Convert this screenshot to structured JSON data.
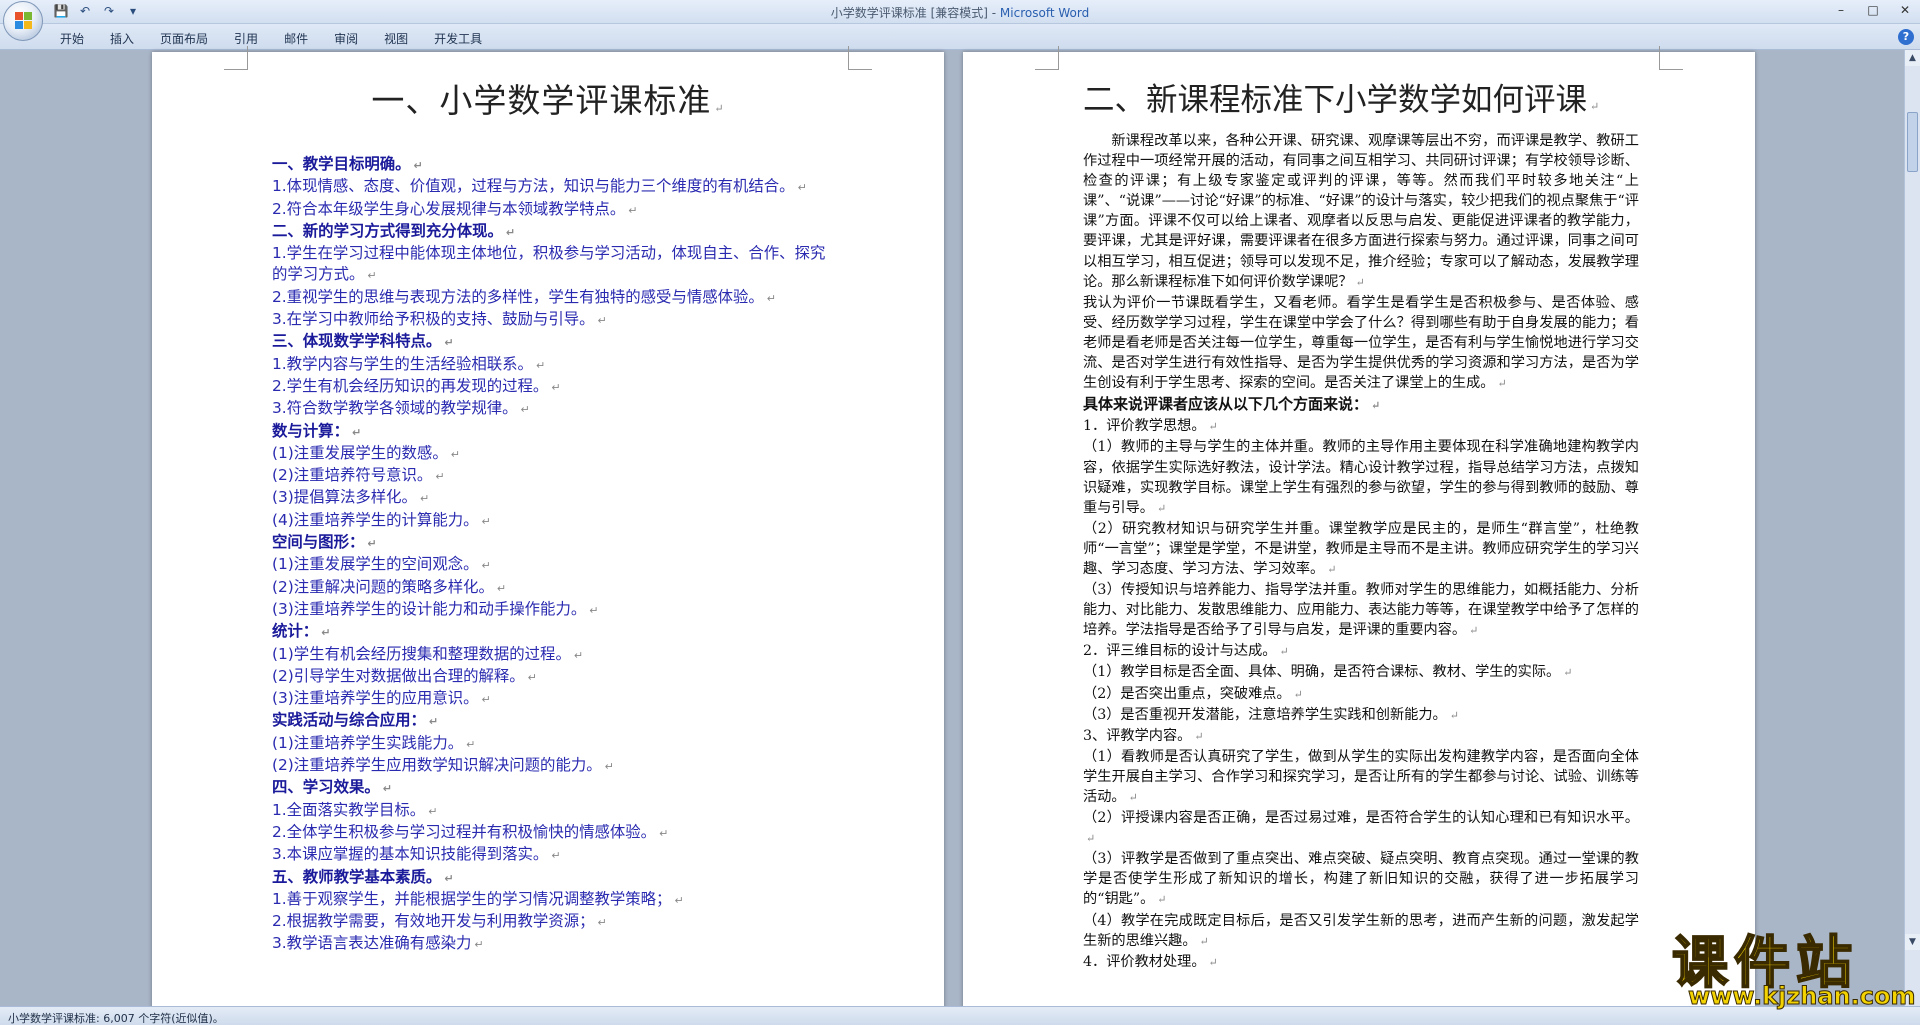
{
  "window": {
    "title": "小学数学评课标准 [兼容模式] - ",
    "app_name": "Microsoft Word",
    "controls": [
      "–",
      "□",
      "✕"
    ]
  },
  "ribbon": {
    "tabs": [
      "开始",
      "插入",
      "页面布局",
      "引用",
      "邮件",
      "审阅",
      "视图",
      "开发工具"
    ],
    "help": "?"
  },
  "page1": {
    "title": "一、小学数学评课标准",
    "lines": [
      {
        "text": "一、教学目标明确。",
        "head": true
      },
      {
        "text": "1.体现情感、态度、价值观，过程与方法，知识与能力三个维度的有机结合。",
        "head": false
      },
      {
        "text": "2.符合本年级学生身心发展规律与本领域教学特点。",
        "head": false
      },
      {
        "text": "二、新的学习方式得到充分体现。",
        "head": true
      },
      {
        "text": "1.学生在学习过程中能体现主体地位，积极参与学习活动，体现自主、合作、探究的学习方式。",
        "head": false
      },
      {
        "text": "2.重视学生的思维与表现方法的多样性，学生有独特的感受与情感体验。",
        "head": false
      },
      {
        "text": "3.在学习中教师给予积极的支持、鼓励与引导。",
        "head": false
      },
      {
        "text": "三、体现数学学科特点。",
        "head": true
      },
      {
        "text": "1.教学内容与学生的生活经验相联系。",
        "head": false
      },
      {
        "text": "2.学生有机会经历知识的再发现的过程。",
        "head": false
      },
      {
        "text": "3.符合数学教学各领域的教学规律。",
        "head": false
      },
      {
        "text": "数与计算：",
        "head": true
      },
      {
        "text": "(1)注重发展学生的数感。",
        "head": false
      },
      {
        "text": "(2)注重培养符号意识。",
        "head": false
      },
      {
        "text": "(3)提倡算法多样化。",
        "head": false
      },
      {
        "text": "(4)注重培养学生的计算能力。",
        "head": false
      },
      {
        "text": "空间与图形：",
        "head": true
      },
      {
        "text": "(1)注重发展学生的空间观念。",
        "head": false
      },
      {
        "text": "(2)注重解决问题的策略多样化。",
        "head": false
      },
      {
        "text": "(3)注重培养学生的设计能力和动手操作能力。",
        "head": false
      },
      {
        "text": "统计：",
        "head": true
      },
      {
        "text": "(1)学生有机会经历搜集和整理数据的过程。",
        "head": false
      },
      {
        "text": "(2)引导学生对数据做出合理的解释。",
        "head": false
      },
      {
        "text": "(3)注重培养学生的应用意识。",
        "head": false
      },
      {
        "text": "实践活动与综合应用：",
        "head": true
      },
      {
        "text": "(1)注重培养学生实践能力。",
        "head": false
      },
      {
        "text": "(2)注重培养学生应用数学知识解决问题的能力。",
        "head": false
      },
      {
        "text": "四、学习效果。",
        "head": true
      },
      {
        "text": "1.全面落实教学目标。",
        "head": false
      },
      {
        "text": "2.全体学生积极参与学习过程并有积极愉快的情感体验。",
        "head": false
      },
      {
        "text": "3.本课应掌握的基本知识技能得到落实。",
        "head": false
      },
      {
        "text": "五、教师教学基本素质。",
        "head": true
      },
      {
        "text": "1.善于观察学生，并能根据学生的学习情况调整教学策略；",
        "head": false
      },
      {
        "text": "2.根据教学需要，有效地开发与利用教学资源；",
        "head": false
      },
      {
        "text": "3.教学语言表达准确有感染力",
        "head": false
      }
    ]
  },
  "page2": {
    "title": "二、新课程标准下小学数学如何评课",
    "paragraphs": [
      {
        "text": "新课程改革以来，各种公开课、研究课、观摩课等层出不穷，而评课是教学、教研工作过程中一项经常开展的活动，有同事之间互相学习、共同研讨评课；有学校领导诊断、检查的评课；有上级专家鉴定或评判的评课，等等。然而我们平时较多地关注“上课”、“说课”——讨论“好课”的标准、“好课”的设计与落实，较少把我们的视点聚焦于“评课”方面。评课不仅可以给上课者、观摩者以反思与启发、更能促进评课者的教学能力，要评课，尤其是评好课，需要评课者在很多方面进行探索与努力。通过评课，同事之间可以相互学习，相互促进；领导可以发现不足，推介经验；专家可以了解动态，发展教学理论。那么新课程标准下如何评价数学课呢？",
        "style": "indent"
      },
      {
        "text": "我认为评价一节课既看学生，又看老师。看学生是看学生是否积极参与、是否体验、感受、经历数学学习过程，学生在课堂中学会了什么？得到哪些有助于自身发展的能力；看老师是看老师是否关注每一位学生，尊重每一位学生，是否有利与学生愉悦地进行学习交流、是否对学生进行有效性指导、是否为学生提供优秀的学习资源和学习方法，是否为学生创设有利于学生思考、探索的空间。是否关注了课堂上的生成。",
        "style": ""
      },
      {
        "text": "具体来说评课者应该从以下几个方面来说：",
        "style": "heading"
      },
      {
        "text": "1．评价教学思想。",
        "style": ""
      },
      {
        "text": "（1）教师的主导与学生的主体并重。教师的主导作用主要体现在科学准确地建构教学内容，依据学生实际选好教法，设计学法。精心设计教学过程，指导总结学习方法，点拨知识疑难，实现教学目标。课堂上学生有强烈的参与欲望，学生的参与得到教师的鼓励、尊重与引导。",
        "style": ""
      },
      {
        "text": "（2）研究教材知识与研究学生并重。课堂教学应是民主的，是师生“群言堂”，杜绝教师“一言堂”；课堂是学堂，不是讲堂，教师是主导而不是主讲。教师应研究学生的学习兴趣、学习态度、学习方法、学习效率。",
        "style": ""
      },
      {
        "text": "（3）传授知识与培养能力、指导学法并重。教师对学生的思维能力，如概括能力、分析能力、对比能力、发散思维能力、应用能力、表达能力等等，在课堂教学中给予了怎样的培养。学法指导是否给予了引导与启发，是评课的重要内容。",
        "style": ""
      },
      {
        "text": "2．评三维目标的设计与达成。",
        "style": ""
      },
      {
        "text": "（1）教学目标是否全面、具体、明确，是否符合课标、教材、学生的实际。",
        "style": ""
      },
      {
        "text": "（2）是否突出重点，突破难点。",
        "style": ""
      },
      {
        "text": "（3）是否重视开发潜能，注意培养学生实践和创新能力。",
        "style": ""
      },
      {
        "text": "3、评教学内容。",
        "style": ""
      },
      {
        "text": "（1）看教师是否认真研究了学生，做到从学生的实际出发构建教学内容，是否面向全体学生开展自主学习、合作学习和探究学习，是否让所有的学生都参与讨论、试验、训练等活动。",
        "style": ""
      },
      {
        "text": "（2）评授课内容是否正确，是否过易过难，是否符合学生的认知心理和已有知识水平。",
        "style": ""
      },
      {
        "text": "（3）评教学是否做到了重点突出、难点突破、疑点突明、教育点突现。通过一堂课的教学是否使学生形成了新知识的增长，构建了新旧知识的交融，获得了进一步拓展学习的“钥匙”。",
        "style": ""
      },
      {
        "text": "（4）教学在完成既定目标后，是否又引发学生新的思考，进而产生新的问题，激发起学生新的思维兴趣。",
        "style": ""
      },
      {
        "text": "4．评价教材处理。",
        "style": ""
      }
    ]
  },
  "statusbar": {
    "text": "小学数学评课标准: 6,007 个字符(近似值)。"
  },
  "watermark": {
    "chinese": "课件站",
    "url": "www.kjzhan.com"
  },
  "colors": {
    "page1_text": "#2a2ab0",
    "ribbon_bg": "#dfe9f6",
    "watermark": "#f2d200"
  }
}
